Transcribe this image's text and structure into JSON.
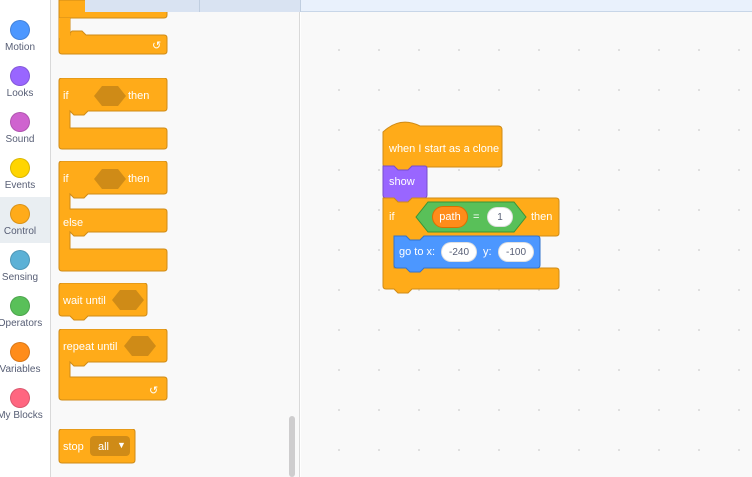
{
  "categories": [
    {
      "label": "Motion",
      "color": "#4c97ff"
    },
    {
      "label": "Looks",
      "color": "#9966ff"
    },
    {
      "label": "Sound",
      "color": "#cf63cf"
    },
    {
      "label": "Events",
      "color": "#ffd500"
    },
    {
      "label": "Control",
      "color": "#ffab19",
      "selected": true
    },
    {
      "label": "Sensing",
      "color": "#5cb1d6"
    },
    {
      "label": "Operators",
      "color": "#59c059"
    },
    {
      "label": "Variables",
      "color": "#ff8c1a"
    },
    {
      "label": "My Blocks",
      "color": "#ff6680"
    }
  ],
  "palette": {
    "if_then": {
      "if": "if",
      "then": "then"
    },
    "if_else": {
      "if": "if",
      "then": "then",
      "else": "else"
    },
    "wait_until": "wait until",
    "repeat_until": "repeat until",
    "stop": {
      "label": "stop",
      "option": "all"
    }
  },
  "script": {
    "hat": "when I start as a clone",
    "show": "show",
    "if": "if",
    "then": "then",
    "variable": "path",
    "operator": "=",
    "compare_value": "1",
    "goto_label": "go to x:",
    "x_value": "-240",
    "y_label": "y:",
    "y_value": "-100"
  },
  "colors": {
    "control": "#ffab19",
    "looks": "#9966ff",
    "motion": "#4c97ff",
    "operators": "#59c059",
    "variables": "#ff8c1a"
  }
}
